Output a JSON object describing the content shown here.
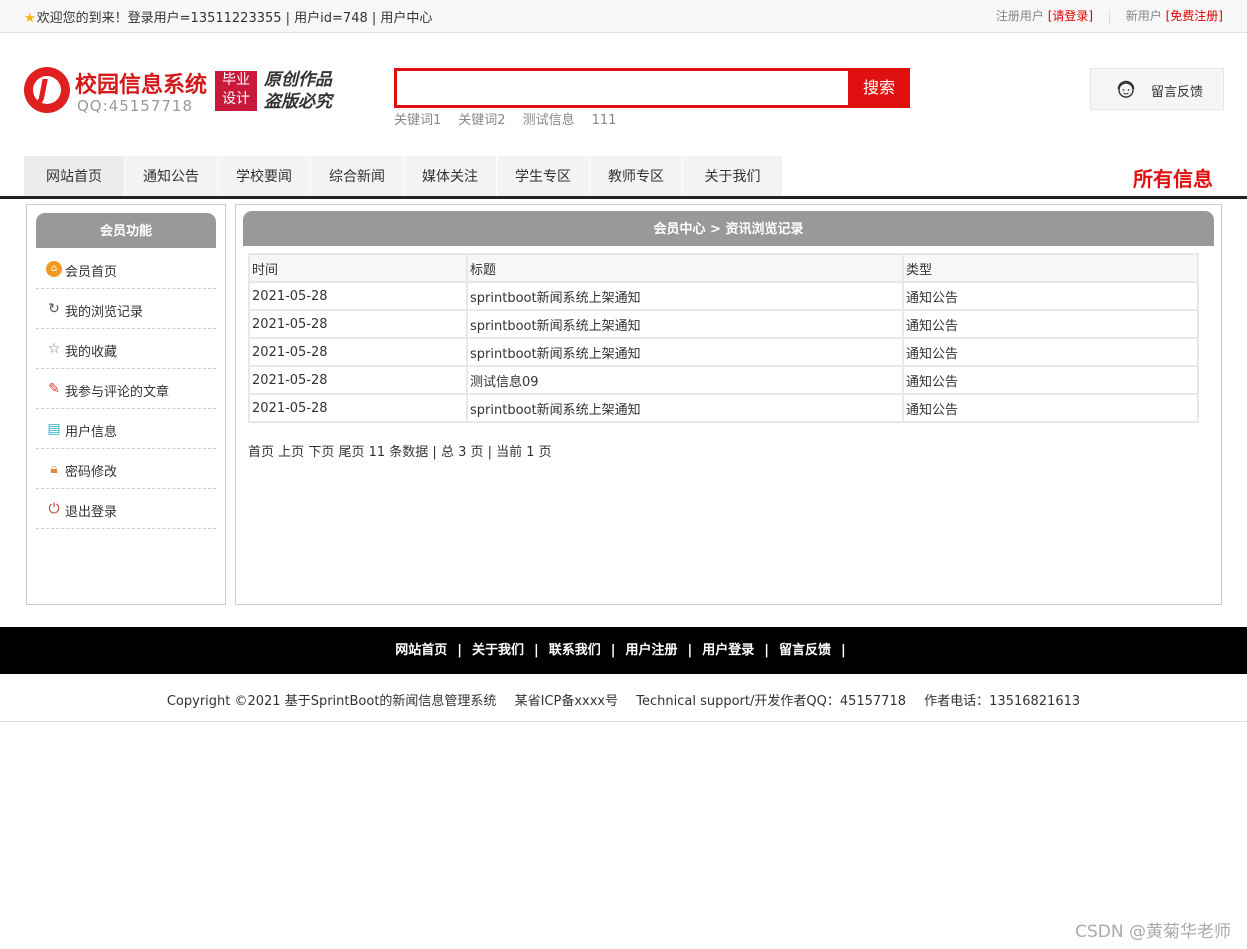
{
  "topbar": {
    "welcome": "欢迎您的到来！登录用户=13511223355 | 用户id=748 | 用户中心",
    "registered_label": "注册用户",
    "login_link": "[请登录]",
    "new_user_label": "新用户",
    "register_link": "[免费注册]"
  },
  "header": {
    "logo_title": "校园信息系统",
    "logo_qq": "QQ:45157718",
    "badge_line1": "毕业",
    "badge_line2": "设计",
    "slogan_line1": "原创作品",
    "slogan_line2": "盗版必究",
    "search_placeholder": "",
    "search_button": "搜索",
    "keywords": [
      "关键词1",
      "关键词2",
      "测试信息",
      "111"
    ],
    "feedback": "留言反馈"
  },
  "nav": {
    "items": [
      "网站首页",
      "通知公告",
      "学校要闻",
      "综合新闻",
      "媒体关注",
      "学生专区",
      "教师专区",
      "关于我们"
    ],
    "all_info": "所有信息"
  },
  "sidebar": {
    "title": "会员功能",
    "items": [
      {
        "label": "会员首页",
        "icon": "home-icon"
      },
      {
        "label": "我的浏览记录",
        "icon": "history-icon"
      },
      {
        "label": "我的收藏",
        "icon": "star-icon"
      },
      {
        "label": "我参与评论的文章",
        "icon": "edit-icon"
      },
      {
        "label": "用户信息",
        "icon": "user-info-icon"
      },
      {
        "label": "密码修改",
        "icon": "lock-icon"
      },
      {
        "label": "退出登录",
        "icon": "power-icon"
      }
    ]
  },
  "main": {
    "title": "会员中心 > 资讯浏览记录",
    "columns": [
      "时间",
      "标题",
      "类型"
    ],
    "rows": [
      [
        "2021-05-28",
        "sprintboot新闻系统上架通知",
        "通知公告"
      ],
      [
        "2021-05-28",
        "sprintboot新闻系统上架通知",
        "通知公告"
      ],
      [
        "2021-05-28",
        "sprintboot新闻系统上架通知",
        "通知公告"
      ],
      [
        "2021-05-28",
        "测试信息09",
        "通知公告"
      ],
      [
        "2021-05-28",
        "sprintboot新闻系统上架通知",
        "通知公告"
      ]
    ],
    "pager": {
      "first": "首页",
      "prev": "上页",
      "next": "下页",
      "last": "尾页",
      "summary": "11 条数据 | 总 3 页 | 当前 1 页"
    }
  },
  "footer": {
    "links": [
      "网站首页",
      "关于我们",
      "联系我们",
      "用户注册",
      "用户登录",
      "留言反馈"
    ],
    "separator": "|",
    "copyright": "Copyright ©2021 基于SprintBoot的新闻信息管理系统",
    "icp": "某省ICP备xxxx号",
    "support": "Technical support/开发作者QQ：45157718",
    "phone": "作者电话：13516821613"
  },
  "watermark": "CSDN @黄菊华老师"
}
